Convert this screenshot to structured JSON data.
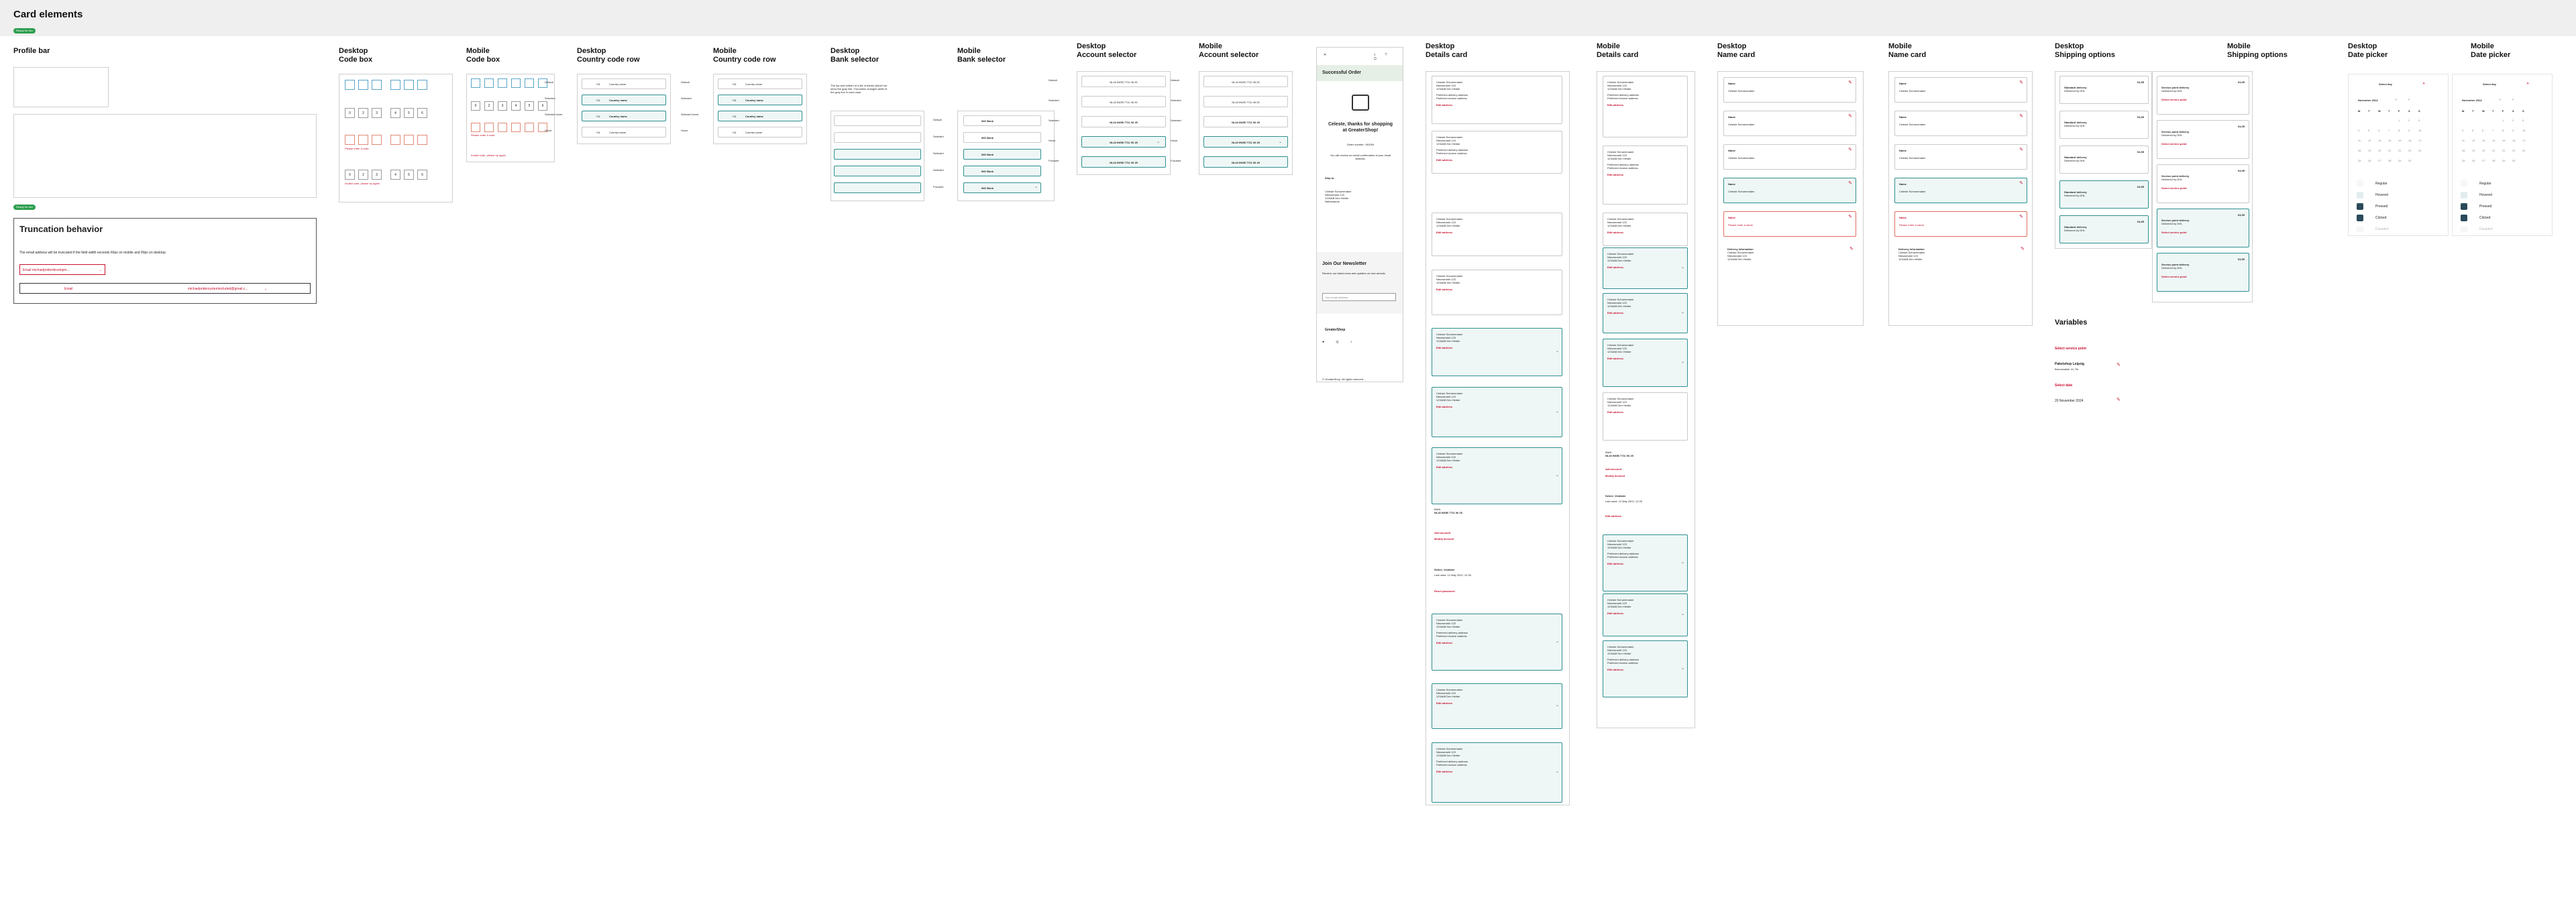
{
  "page": {
    "title": "Card elements",
    "badge": "Ready for dev"
  },
  "profile": {
    "title": "Profile bar",
    "badge": "Ready for dev",
    "trunc_title": "Truncation behavior",
    "trunc_desc": "The email address will be truncated if the field width exceeds 60px on mobile and 90px on desktop.",
    "email1": "Email   michaelpriderdevelopm...",
    "email2_label": "Email",
    "email2": "michaelpridersystemincluded@gmail.c..."
  },
  "codebox": {
    "desktop_title": "Desktop\nCode box",
    "mobile_title": "Mobile\nCode box",
    "digits": [
      "0",
      "2",
      "3",
      "4",
      "5",
      "6"
    ],
    "error": "Please enter a code",
    "error2": "Invalid code, please try again"
  },
  "country": {
    "desktop_title": "Desktop\nCountry code row",
    "mobile_title": "Mobile\nCountry code row",
    "label": "Country name",
    "code": "+31",
    "states": [
      "Default",
      "Selected",
      "Selected hover",
      "Hover"
    ]
  },
  "bank": {
    "desktop_title": "Desktop\nBank selector",
    "mobile_title": "Mobile\nBank selector",
    "desc": "The top and bottom of a list of banks should not show the gray line. Truncation changes width of the gray line in each case.",
    "states": [
      "Default",
      "Selected",
      "Selected",
      "Selected",
      "Focused"
    ],
    "item": "ING Bank"
  },
  "account": {
    "desktop_title": "Desktop\nAccount selector",
    "mobile_title": "Mobile\nAccount selector",
    "value": "NL43 INGB 7711 06 25",
    "states": [
      "Default",
      "Selected",
      "Selected",
      "Hover",
      "Focused"
    ]
  },
  "order": {
    "title": "Successful Order",
    "thanks": "Celeste, thanks for shopping\nat GreaterShop!",
    "order_no": "Order number: 190254",
    "info": "You will receive an email confirmation at your email address.",
    "ship_title": "Ship to",
    "ship_lines": [
      "Celeste Schoenmaker",
      "Nieuwmarkt 123",
      "1234AB Den Helder",
      "Netherlands"
    ],
    "news_title": "Join Our Newsletter",
    "news_desc": "Receive our latest news and updates on new arrivals.",
    "news_input": "Your email address",
    "brand": "GreaterShop",
    "footer": "© GreaterShop. All rights reserved."
  },
  "details": {
    "desktop_title": "Desktop\nDetails card",
    "mobile_title": "Mobile\nDetails card",
    "name": "Celeste Schoenmaker",
    "line2": "Nieuwmarkt 123",
    "line3": "1234AB Den Helder",
    "edit": "Edit address",
    "billing": "Billing address",
    "pref": "Preferred delivery address",
    "pref2": "Preferred invoice address",
    "iban_label": "IBAN",
    "iban": "NL43 INGB 7711 06 25",
    "inv": "Invoice to",
    "add": "Add account",
    "modify": "Modify account",
    "reset": "Reset password",
    "select_h": "Select_Vestiaire",
    "last_used": "Last used: 12 May 2022, 12:26"
  },
  "namecard": {
    "desktop_title": "Desktop\nName card",
    "mobile_title": "Mobile\nName card",
    "label": "Name",
    "value": "Celeste Schoenmaker",
    "error": "Please enter a name",
    "delivery": "Delivery information"
  },
  "shipping": {
    "desktop_title": "Desktop\nShipping options",
    "mobile_title": "Mobile\nShipping options",
    "standard": "Standard delivery",
    "standard_sub": "Delivered by DHL",
    "service": "Service point delivery",
    "service_sub": "Delivered by DHL",
    "price": "€4,95",
    "select_point": "Select service point",
    "var_title": "Variables",
    "var1": "Select service point",
    "var2": "Paketshop Leipzig",
    "var2b": "Brunowallstr. 41-7th",
    "var3": "Select date",
    "var4": "20 November 2024"
  },
  "date": {
    "desktop_title": "Desktop\nDate picker",
    "mobile_title": "Mobile\nDate picker",
    "header": "Select day",
    "month": "November 2024",
    "days": [
      "M",
      "T",
      "W",
      "T",
      "F",
      "S",
      "S"
    ],
    "states": [
      "Regular",
      "Hovered",
      "Pressed",
      "Clicked",
      "Disabled"
    ]
  }
}
